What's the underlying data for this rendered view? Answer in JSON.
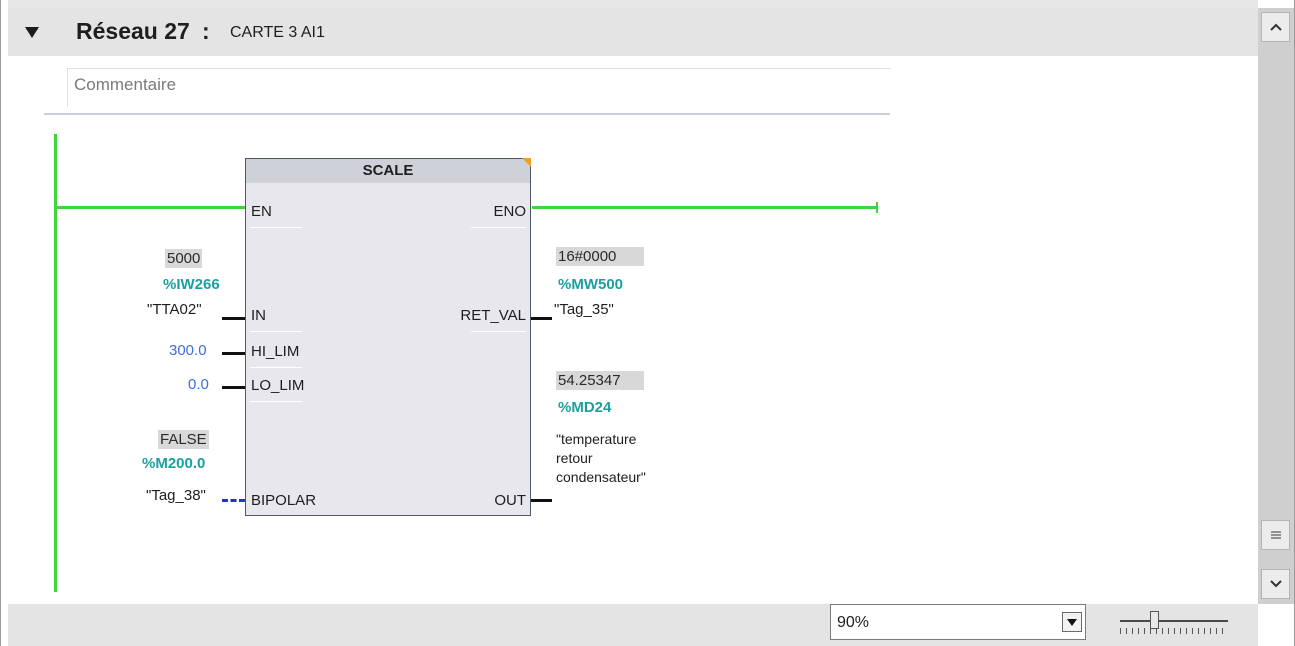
{
  "network": {
    "title": "Réseau 27",
    "colon": ":",
    "subtitle": "CARTE 3 AI1",
    "comment_placeholder": "Commentaire"
  },
  "block": {
    "name": "SCALE",
    "inputs": [
      "EN",
      "IN",
      "HI_LIM",
      "LO_LIM",
      "BIPOLAR"
    ],
    "outputs": [
      "ENO",
      "RET_VAL",
      "OUT"
    ]
  },
  "operands": {
    "in": {
      "value": "5000",
      "address": "%IW266",
      "tag": "\"TTA02\""
    },
    "hi_lim": {
      "const": "300.0"
    },
    "lo_lim": {
      "const": "0.0"
    },
    "bipolar": {
      "value": "FALSE",
      "address": "%M200.0",
      "tag": "\"Tag_38\""
    },
    "ret_val": {
      "value": "16#0000",
      "address": "%MW500",
      "tag": "\"Tag_35\""
    },
    "out": {
      "value": "54.25347",
      "address": "%MD24",
      "tag_lines": [
        "\"temperature",
        "retour",
        "condensateur\""
      ]
    }
  },
  "colors": {
    "power_flow": "#3dd63d",
    "address": "#1ba0a0",
    "constant": "#3d6fd8",
    "dashed_wire": "#2233dd",
    "corner_flag": "#f2a01c"
  },
  "footer": {
    "zoom": "90%"
  },
  "icons": {
    "collapse": "triangle-down-icon",
    "scroll_up": "chevron-up-icon",
    "scroll_down": "chevron-down-icon",
    "scroll_grip": "grip-lines-icon"
  }
}
